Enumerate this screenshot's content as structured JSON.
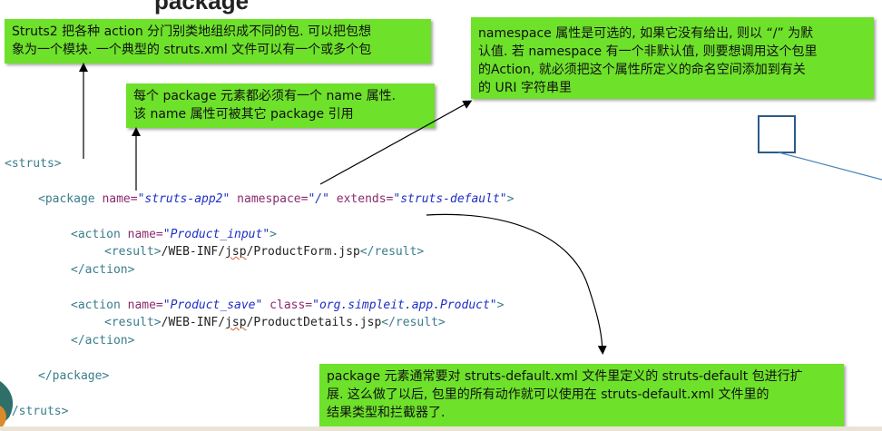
{
  "title_fragment": "package",
  "notes": {
    "note1": [
      "Struts2 把各种 action 分门别类地组织成不同的包. 可以把包想",
      "象为一个模块. 一个典型的 struts.xml 文件可以有一个或多个包"
    ],
    "note2": [
      "每个 package 元素都必须有一个 name 属性.",
      "该 name 属性可被其它 package 引用"
    ],
    "note3": [
      "namespace 属性是可选的, 如果它没有给出, 则以 “/” 为默",
      "认值. 若 namespace 有一个非默认值, 则要想调用这个包里",
      "的Action, 就必须把这个属性所定义的命名空间添加到有关",
      "的 URI 字符串里"
    ],
    "note4": [
      "package 元素通常要对 struts-default.xml 文件里定义的 struts-default 包进行扩",
      "展. 这么做了以后, 包里的所有动作就可以使用在 struts-default.xml 文件里的",
      "结果类型和拦截器了."
    ]
  },
  "code": {
    "struts_open": "<struts>",
    "package_open_tag": "<package",
    "package_name_attr": "name=",
    "package_name_val": "\"struts-app2\"",
    "package_ns_attr": "namespace=",
    "package_ns_val": "\"/\"",
    "package_ext_attr": "extends=",
    "package_ext_val": "\"struts-default\"",
    "gt": ">",
    "action_open": "<action",
    "name_attr": "name=",
    "action1_name": "\"Product_input\"",
    "result_open": "<result>",
    "result1_text_a": "/WEB-INF/",
    "jsp": "jsp",
    "result1_text_b": "/ProductForm.jsp",
    "result_close": "</result>",
    "action_close": "</action>",
    "action2_name": "\"Product_save\"",
    "class_attr": "class=",
    "action2_class": "\"org.simpleit.app.Product\"",
    "result2_text_b": "/ProductDetails.jsp",
    "package_close": "</package>",
    "struts_close": "</struts>"
  },
  "colors": {
    "note_bg": "#6ee12a",
    "tag": "#3a7d8c",
    "attr": "#8a2a6e",
    "value": "#1d2ec4"
  }
}
